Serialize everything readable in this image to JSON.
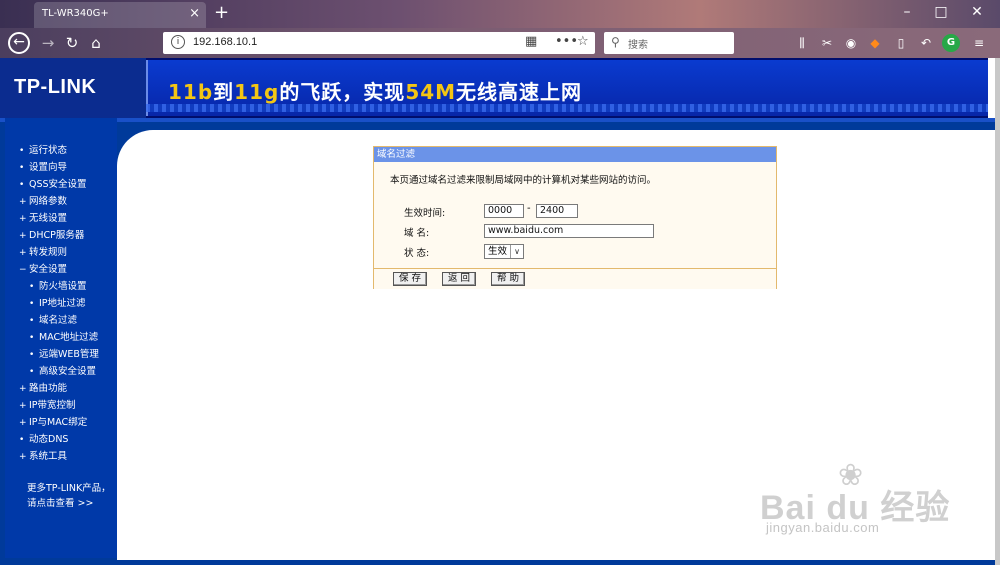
{
  "browser": {
    "tab_title": "TL-WR340G+",
    "tab_close": "×",
    "new_tab": "+",
    "url": "192.168.10.1",
    "url_info_glyph": "i",
    "search_placeholder": "搜索",
    "window_minimize": "–",
    "window_maximize": "□",
    "window_close": "✕",
    "ext_g_label": "G"
  },
  "banner": {
    "logo": "TP-LINK",
    "slogan_parts": {
      "p1": "11b",
      "p2": "到",
      "p3": "11g",
      "p4": "的飞跃，实现",
      "p5": "54M",
      "p6": "无线高速上网"
    }
  },
  "sidebar": {
    "items": [
      {
        "label": "运行状态",
        "bullet": "•"
      },
      {
        "label": "设置向导",
        "bullet": "•"
      },
      {
        "label": "QSS安全设置",
        "bullet": "•"
      },
      {
        "label": "网络参数",
        "bullet": "+"
      },
      {
        "label": "无线设置",
        "bullet": "+"
      },
      {
        "label": "DHCP服务器",
        "bullet": "+"
      },
      {
        "label": "转发规则",
        "bullet": "+"
      },
      {
        "label": "安全设置",
        "bullet": "−"
      },
      {
        "label": "防火墙设置",
        "bullet": "•"
      },
      {
        "label": "IP地址过滤",
        "bullet": "•"
      },
      {
        "label": "域名过滤",
        "bullet": "•"
      },
      {
        "label": "MAC地址过滤",
        "bullet": "•"
      },
      {
        "label": "远端WEB管理",
        "bullet": "•"
      },
      {
        "label": "高级安全设置",
        "bullet": "•"
      },
      {
        "label": "路由功能",
        "bullet": "+"
      },
      {
        "label": "IP带宽控制",
        "bullet": "+"
      },
      {
        "label": "IP与MAC绑定",
        "bullet": "+"
      },
      {
        "label": "动态DNS",
        "bullet": "•"
      },
      {
        "label": "系统工具",
        "bullet": "+"
      }
    ],
    "footer_line1": "更多TP-LINK产品，",
    "footer_line2": "请点击查看 >>"
  },
  "panel": {
    "title": "域名过滤",
    "description": "本页通过域名过滤来限制局域网中的计算机对某些网站的访问。",
    "time_label": "生效时间:",
    "time_start": "0000",
    "time_dash": "-",
    "time_end": "2400",
    "domain_label": "域 名:",
    "domain_value": "www.baidu.com",
    "status_label": "状 态:",
    "status_value": "生效",
    "buttons": {
      "save": "保 存",
      "back": "返 回",
      "help": "帮 助"
    }
  },
  "watermark": {
    "main": "Bai du 经验",
    "sub": "jingyan.baidu.com"
  }
}
